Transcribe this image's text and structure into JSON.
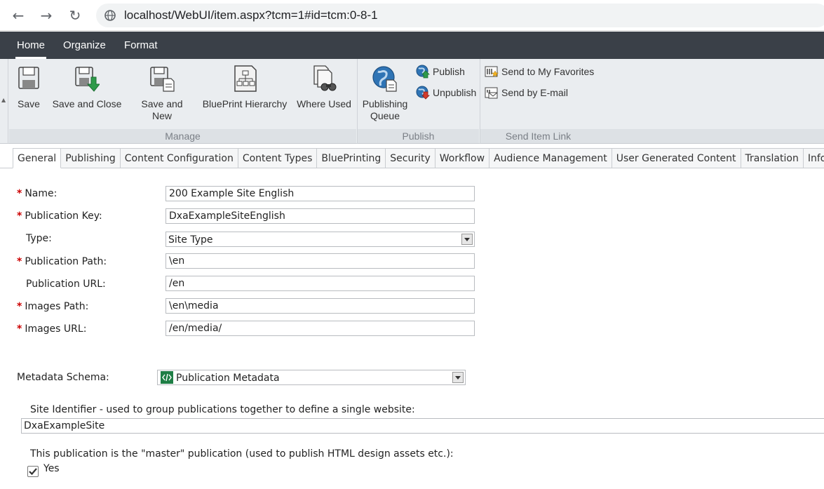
{
  "browser": {
    "url": "localhost/WebUI/item.aspx?tcm=1#id=tcm:0-8-1",
    "back_glyph": "←",
    "forward_glyph": "→",
    "reload_glyph": "↻"
  },
  "menu": {
    "items": [
      {
        "label": "Home",
        "active": true
      },
      {
        "label": "Organize",
        "active": false
      },
      {
        "label": "Format",
        "active": false
      }
    ]
  },
  "ribbon": {
    "groups": {
      "manage": {
        "label": "Manage",
        "buttons": [
          {
            "label": "Save",
            "icon": "save-icon"
          },
          {
            "label": "Save and Close",
            "icon": "save-close-icon"
          },
          {
            "label_line1": "Save and",
            "label_line2": "New",
            "icon": "save-new-icon"
          },
          {
            "label": "BluePrint Hierarchy",
            "icon": "blueprint-hierarchy-icon"
          },
          {
            "label": "Where Used",
            "icon": "where-used-icon"
          }
        ]
      },
      "publish": {
        "label": "Publish",
        "queue": {
          "label_line1": "Publishing",
          "label_line2": "Queue",
          "icon": "globe-icon"
        },
        "publish": "Publish",
        "unpublish": "Unpublish"
      },
      "send": {
        "label": "Send Item Link",
        "favorites": "Send to My Favorites",
        "email": "Send by E-mail"
      }
    }
  },
  "tabs": [
    {
      "label": "General",
      "active": true
    },
    {
      "label": "Publishing"
    },
    {
      "label": "Content Configuration"
    },
    {
      "label": "Content Types"
    },
    {
      "label": "BluePrinting"
    },
    {
      "label": "Security"
    },
    {
      "label": "Workflow"
    },
    {
      "label": "Audience Management"
    },
    {
      "label": "User Generated Content"
    },
    {
      "label": "Translation"
    },
    {
      "label": "Info"
    }
  ],
  "form": {
    "required_marker": "*",
    "name": {
      "label": "Name:",
      "value": "200 Example Site English"
    },
    "publication_key": {
      "label": "Publication Key:",
      "value": "DxaExampleSiteEnglish"
    },
    "type": {
      "label": "Type:",
      "value": "Site Type"
    },
    "publication_path": {
      "label": "Publication Path:",
      "value": "\\en"
    },
    "publication_url": {
      "label": "Publication URL:",
      "value": "/en"
    },
    "images_path": {
      "label": "Images Path:",
      "value": "\\en\\media"
    },
    "images_url": {
      "label": "Images URL:",
      "value": "/en/media/"
    },
    "metadata_schema": {
      "label": "Metadata Schema:",
      "value": "Publication Metadata"
    },
    "site_identifier": {
      "label": "Site Identifier - used to group publications together to define a single website:",
      "value": "DxaExampleSite"
    },
    "master": {
      "label": "This publication is the \"master\" publication (used to publish HTML design assets etc.):",
      "option": "Yes",
      "checked": true
    }
  },
  "colors": {
    "menubar": "#3a4048",
    "ribbon": "#eaedf0",
    "required": "#cc0000",
    "schema_icon": "#1e7e45"
  }
}
